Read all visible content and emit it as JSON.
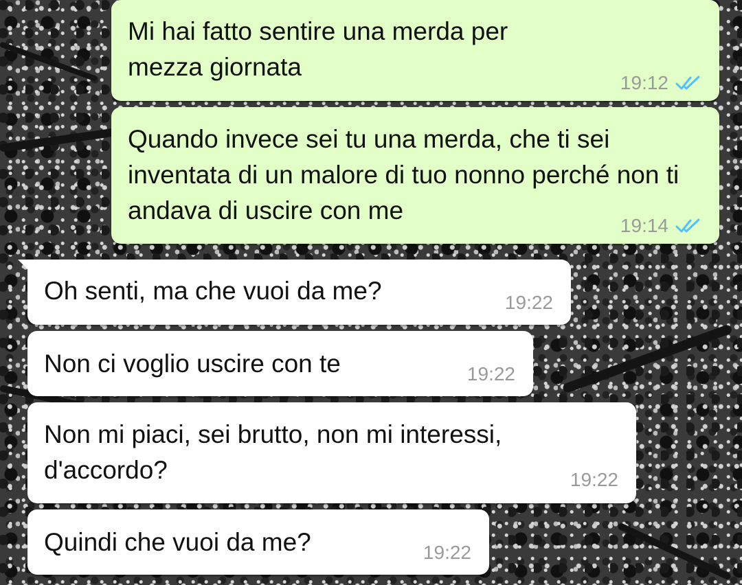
{
  "colors": {
    "outgoing_bubble": "#e1ffc7",
    "incoming_bubble": "#ffffff",
    "read_ticks": "#4fc3f7",
    "timestamp": "#9a9a9a"
  },
  "messages": [
    {
      "direction": "outgoing",
      "text": "Mi hai fatto sentire una merda per mezza giornata",
      "time": "19:12",
      "status_icon": "double-check-read-icon"
    },
    {
      "direction": "outgoing",
      "text": "Quando invece sei tu una merda, che ti sei inventata di un malore di tuo nonno perché non ti andava di uscire con me",
      "time": "19:14",
      "status_icon": "double-check-read-icon"
    },
    {
      "direction": "incoming",
      "text": "Oh senti, ma che vuoi da me?",
      "time": "19:22"
    },
    {
      "direction": "incoming",
      "text": "Non ci voglio uscire con te",
      "time": "19:22"
    },
    {
      "direction": "incoming",
      "text": "Non mi piaci, sei brutto, non mi interessi, d'accordo?",
      "time": "19:22"
    },
    {
      "direction": "incoming",
      "text": "Quindi che vuoi da me?",
      "time": "19:22"
    }
  ]
}
